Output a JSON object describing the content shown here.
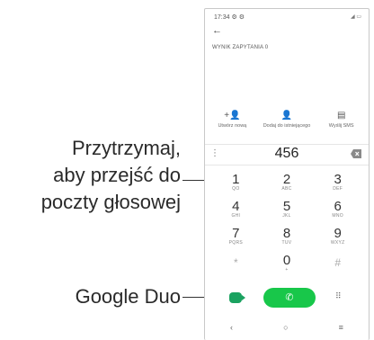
{
  "callouts": {
    "voicemail": [
      "Przytrzymaj,",
      "aby przejść do",
      "poczty głosowej"
    ],
    "duo": "Google Duo"
  },
  "status": {
    "time": "17:34",
    "icons_left": "⚙ ⚙",
    "icons_right": "◢ ▭"
  },
  "header": {
    "back_glyph": "←",
    "result_label": "WYNIK ZAPYTANIA 0"
  },
  "actions": [
    {
      "icon": "add-contact-icon",
      "glyph": "+👤",
      "label": "Utwórz nową"
    },
    {
      "icon": "person-icon",
      "glyph": "👤",
      "label": "Dodaj do istniejącego"
    },
    {
      "icon": "message-icon",
      "glyph": "▤",
      "label": "Wyślij SMS"
    }
  ],
  "dial": {
    "menu_glyph": "⋮",
    "number": "456"
  },
  "keypad": [
    [
      {
        "d": "1",
        "l": "QO"
      },
      {
        "d": "2",
        "l": "ABC"
      },
      {
        "d": "3",
        "l": "DEF"
      }
    ],
    [
      {
        "d": "4",
        "l": "GHI"
      },
      {
        "d": "5",
        "l": "JKL"
      },
      {
        "d": "6",
        "l": "MNO"
      }
    ],
    [
      {
        "d": "7",
        "l": "PQRS"
      },
      {
        "d": "8",
        "l": "TUV"
      },
      {
        "d": "9",
        "l": "WXYZ"
      }
    ],
    [
      {
        "d": "*",
        "l": ""
      },
      {
        "d": "0",
        "l": "+"
      },
      {
        "d": "#",
        "l": ""
      }
    ]
  ],
  "callbar": {
    "call_glyph": "✆",
    "grid_glyph": "⠿"
  },
  "navbar": {
    "back": "‹",
    "home": "○",
    "recents": "≡"
  },
  "colors": {
    "call_green": "#18c74a",
    "duo_green": "#1aa260"
  }
}
